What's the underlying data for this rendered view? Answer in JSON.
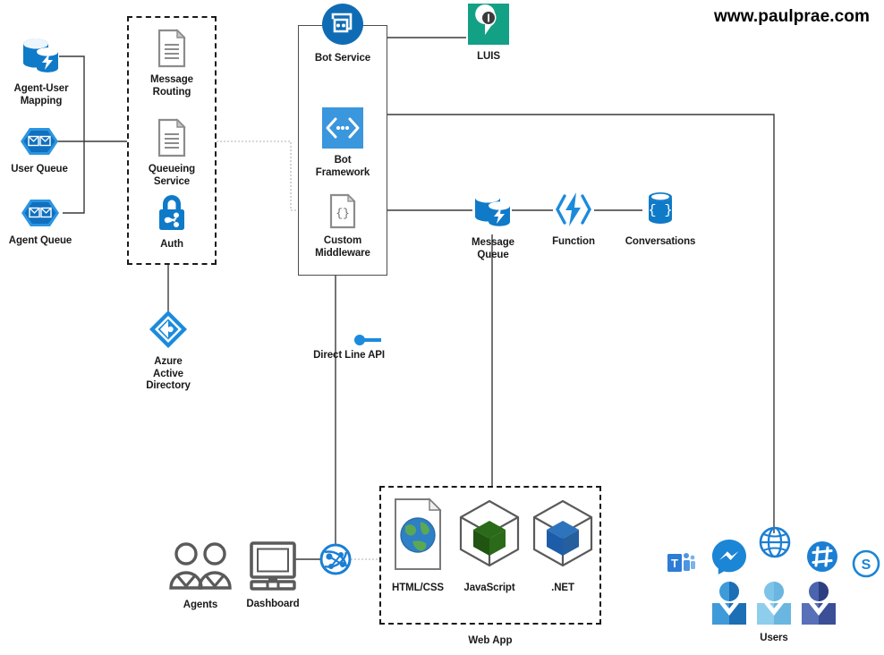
{
  "watermark": "www.paulprae.com",
  "groups": {
    "services_box": {
      "name": "services-box"
    },
    "botframework_box": {
      "name": "bot-framework-box"
    },
    "webapp_box": {
      "label": "Web App"
    }
  },
  "nodes": {
    "agent_user_mapping": {
      "label": "Agent-User\nMapping",
      "icon": "database-replica-icon",
      "color": "#0f7ac8"
    },
    "user_queue": {
      "label": "User Queue",
      "icon": "queue-hexagon-icon",
      "color": "#0f7ac8"
    },
    "agent_queue": {
      "label": "Agent Queue",
      "icon": "queue-hexagon-icon",
      "color": "#0f7ac8"
    },
    "message_routing": {
      "label": "Message\nRouting",
      "icon": "document-icon",
      "color": "#8c8c8c"
    },
    "queueing_service": {
      "label": "Queueing\nService",
      "icon": "document-icon",
      "color": "#8c8c8c"
    },
    "auth": {
      "label": "Auth",
      "icon": "lock-share-icon",
      "color": "#0f7ac8"
    },
    "azure_ad": {
      "label": "Azure\nActive\nDirectory",
      "icon": "azure-active-directory-icon",
      "color": "#1b8bdc"
    },
    "bot_service": {
      "label": "Bot Service",
      "icon": "bot-service-icon",
      "color": "#0f6cb4"
    },
    "bot_framework": {
      "label": "Bot\nFramework",
      "icon": "bot-framework-code-icon",
      "color": "#3a96dd"
    },
    "custom_middleware": {
      "label": "Custom\nMiddleware",
      "icon": "code-document-icon",
      "color": "#8c8c8c"
    },
    "direct_line_api": {
      "label": "Direct Line API",
      "icon": "direct-line-api-icon",
      "color": "#1b8bdc"
    },
    "luis": {
      "label": "LUIS",
      "icon": "luis-icon",
      "color": "#13a186"
    },
    "message_queue": {
      "label": "Message\nQueue",
      "icon": "database-replica-icon",
      "color": "#0f7ac8"
    },
    "function": {
      "label": "Function",
      "icon": "azure-function-icon",
      "color": "#1b8bdc"
    },
    "conversations": {
      "label": "Conversations",
      "icon": "cosmos-db-icon",
      "color": "#0f7ac8"
    },
    "agents": {
      "label": "Agents",
      "icon": "users-outline-icon",
      "color": "#5a5a5a"
    },
    "dashboard": {
      "label": "Dashboard",
      "icon": "monitor-icon",
      "color": "#5a5a5a"
    },
    "network": {
      "label": "",
      "icon": "network-globe-icon",
      "color": "#1b8bdc"
    },
    "html_css": {
      "label": "HTML/CSS",
      "icon": "web-page-globe-icon",
      "color": "#7a7a7a"
    },
    "javascript": {
      "label": "JavaScript",
      "icon": "package-cube-green-icon",
      "color": "#2a6a18"
    },
    "dotnet": {
      "label": ".NET",
      "icon": "package-cube-blue-icon",
      "color": "#1d5ca8"
    },
    "users": {
      "label": "Users",
      "icon": "users-group-icon",
      "color": "#2a7ac0"
    }
  },
  "channels": [
    {
      "name": "microsoft-teams",
      "icon": "teams-icon"
    },
    {
      "name": "facebook-messenger",
      "icon": "messenger-icon"
    },
    {
      "name": "web-chat",
      "icon": "globe-icon"
    },
    {
      "name": "slack",
      "icon": "slack-icon"
    },
    {
      "name": "skype",
      "icon": "skype-icon"
    }
  ],
  "colors": {
    "azure_blue": "#0f7ac8",
    "light_blue": "#3a96dd",
    "teal": "#13a186",
    "gray": "#8c8c8c",
    "dark_gray": "#5a5a5a",
    "line": "#3a3a3a"
  }
}
